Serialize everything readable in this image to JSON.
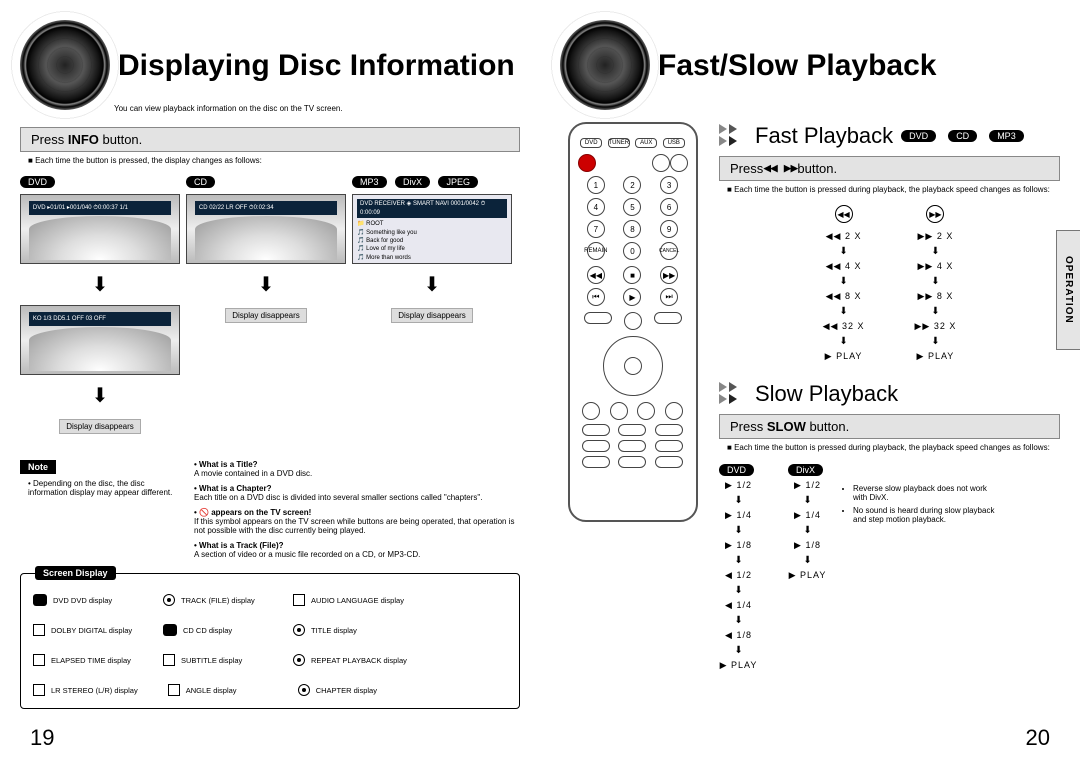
{
  "left": {
    "title": "Displaying Disc Information",
    "subtitle": "You can view playback information on the disc on the TV screen.",
    "press_button": "INFO",
    "each_time": "Each time the button is pressed, the display changes as follows:",
    "display_disappears": "Display disappears",
    "osd": [
      {
        "label": "DVD",
        "bar": "DVD  ▸01/01  ▸001/040  ⏱0:00:37  1/1",
        "bar2": "KO 1/3  DD5.1  OFF  03  OFF"
      },
      {
        "label": "CD",
        "bar": "CD  02/22  LR  OFF  ⏱0:02:34"
      },
      {
        "labels": [
          "MP3",
          "DivX",
          "JPEG"
        ],
        "header": "DVD RECEIVER   ◈ SMART NAVI   0001/0042  ⏱0:00:09",
        "items": [
          "ROOT",
          "Something like you",
          "Back for good",
          "Love of my life",
          "More than words"
        ]
      }
    ],
    "note_label": "Note",
    "note_text": "Depending on the disc, the disc information display may appear different.",
    "defs": [
      {
        "q": "What is a Title?",
        "a": "A movie contained in a DVD disc."
      },
      {
        "q": "What is a Chapter?",
        "a": "Each title on a DVD disc is divided into several smaller sections called \"chapters\"."
      },
      {
        "q": "appears on the TV screen!",
        "a": "If this symbol appears on the TV screen while buttons are being operated, that operation is not possible with the disc currently being played."
      },
      {
        "q": "What is a Track (File)?",
        "a": "A section of video or a music file recorded on a CD, or MP3-CD."
      }
    ],
    "legend_title": "Screen Display",
    "legend": [
      "DVD  DVD display",
      "TRACK (FILE) display",
      "AUDIO LANGUAGE display",
      "DOLBY DIGITAL display",
      "CD  CD display",
      "TITLE display",
      "ELAPSED TIME display",
      "SUBTITLE display",
      "REPEAT PLAYBACK display",
      "LR  STEREO (L/R) display",
      "ANGLE display",
      "CHAPTER display"
    ],
    "page_num": "19"
  },
  "right": {
    "title": "Fast/Slow Playback",
    "side_tab": "OPERATION",
    "fast": {
      "title": "Fast Playback",
      "media": [
        "DVD",
        "CD",
        "MP3"
      ],
      "note": "Each time the button is pressed during playback, the playback speed changes as follows:",
      "rew": [
        "◀◀ 2 X",
        "◀◀ 4 X",
        "◀◀ 8 X",
        "◀◀ 32 X",
        "▶ PLAY"
      ],
      "fwd": [
        "▶▶ 2 X",
        "▶▶ 4 X",
        "▶▶ 8 X",
        "▶▶ 32 X",
        "▶ PLAY"
      ]
    },
    "slow": {
      "title": "Slow Playback",
      "button": "SLOW",
      "note": "Each time the button is pressed during playback, the playback speed changes as follows:",
      "cols": [
        {
          "label": "DVD",
          "steps": [
            "▶ 1/2",
            "▶ 1/4",
            "▶ 1/8",
            "◀ 1/2",
            "◀ 1/4",
            "◀ 1/8",
            "▶ PLAY"
          ]
        },
        {
          "label": "DivX",
          "steps": [
            "▶ 1/2",
            "▶ 1/4",
            "▶ 1/8",
            "▶ PLAY"
          ]
        }
      ],
      "caveats": [
        "Reverse slow playback does not work with DivX.",
        "No sound is heard during slow playback and step motion playback."
      ]
    },
    "page_num": "20"
  }
}
